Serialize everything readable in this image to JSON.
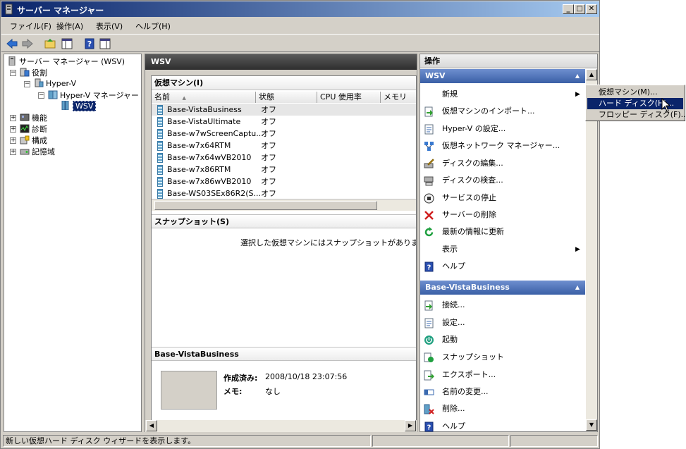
{
  "window": {
    "title": "サーバー マネージャー",
    "btn_min": "_",
    "btn_max": "□",
    "btn_close": "✕"
  },
  "menu": [
    "ファイル(F)",
    "操作(A)",
    "表示(V)",
    "ヘルプ(H)"
  ],
  "tree": {
    "root": "サーバー マネージャー (WSV)",
    "roles": "役割",
    "hyperv": "Hyper-V",
    "hyperv_mgr": "Hyper-V マネージャー",
    "wsv": "WSV",
    "features": "機能",
    "diagnostics": "診断",
    "config": "構成",
    "storage": "記憶域",
    "expand": "+",
    "collapse": "−"
  },
  "center": {
    "title": "WSV",
    "vm_section": "仮想マシン(I)",
    "columns": [
      "名前",
      "状態",
      "CPU 使用率",
      "メモリ"
    ],
    "sort_glyph": "▲",
    "vms": [
      {
        "name": "Base-VistaBusiness",
        "state": "オフ"
      },
      {
        "name": "Base-VistaUltimate",
        "state": "オフ"
      },
      {
        "name": "Base-w7wScreenCaptu...",
        "state": "オフ"
      },
      {
        "name": "Base-w7x64RTM",
        "state": "オフ"
      },
      {
        "name": "Base-w7x64wVB2010",
        "state": "オフ"
      },
      {
        "name": "Base-w7x86RTM",
        "state": "オフ"
      },
      {
        "name": "Base-w7x86wVB2010",
        "state": "オフ"
      },
      {
        "name": "Base-WS03SEx86R2(S...",
        "state": "オフ"
      }
    ],
    "snapshot_section": "スナップショット(S)",
    "snapshot_empty": "選択した仮想マシンにはスナップショットがありません。",
    "details_title": "Base-VistaBusiness",
    "created_label": "作成済み:",
    "created_value": "2008/10/18 23:07:56",
    "memo_label": "メモ:",
    "memo_value": "なし"
  },
  "actions": {
    "title": "操作",
    "group1": "WSV",
    "group1_items": [
      {
        "label": "新規",
        "icon": "new-submenu",
        "arrow": "▶"
      },
      {
        "label": "仮想マシンのインポート...",
        "icon": "import-icon"
      },
      {
        "label": "Hyper-V の設定...",
        "icon": "settings-icon"
      },
      {
        "label": "仮想ネットワーク マネージャー...",
        "icon": "network-icon"
      },
      {
        "label": "ディスクの編集...",
        "icon": "edit-disk-icon"
      },
      {
        "label": "ディスクの検査...",
        "icon": "inspect-disk-icon"
      },
      {
        "label": "サービスの停止",
        "icon": "stop-icon"
      },
      {
        "label": "サーバーの削除",
        "icon": "delete-icon"
      },
      {
        "label": "最新の情報に更新",
        "icon": "refresh-icon"
      },
      {
        "label": "表示",
        "icon": "",
        "arrow": "▶"
      },
      {
        "label": "ヘルプ",
        "icon": "help-icon"
      }
    ],
    "group2": "Base-VistaBusiness",
    "group2_items": [
      {
        "label": "接続...",
        "icon": "connect-icon"
      },
      {
        "label": "設定...",
        "icon": "settings-icon"
      },
      {
        "label": "起動",
        "icon": "start-icon"
      },
      {
        "label": "スナップショット",
        "icon": "snapshot-icon"
      },
      {
        "label": "エクスポート...",
        "icon": "export-icon"
      },
      {
        "label": "名前の変更...",
        "icon": "rename-icon"
      },
      {
        "label": "削除...",
        "icon": "delete-icon"
      },
      {
        "label": "ヘルプ",
        "icon": "help-icon"
      }
    ]
  },
  "context_menu": {
    "items": [
      "仮想マシン(M)...",
      "ハード ディスク(H)...",
      "フロッピー ディスク(F)..."
    ],
    "highlighted_index": 1
  },
  "status_bar": {
    "text": "新しい仮想ハード ディスク ウィザードを表示します。"
  },
  "colors": {
    "accent": "#3a5fa6",
    "highlight": "#0a246a",
    "selected_row": "#e6e6e6"
  }
}
